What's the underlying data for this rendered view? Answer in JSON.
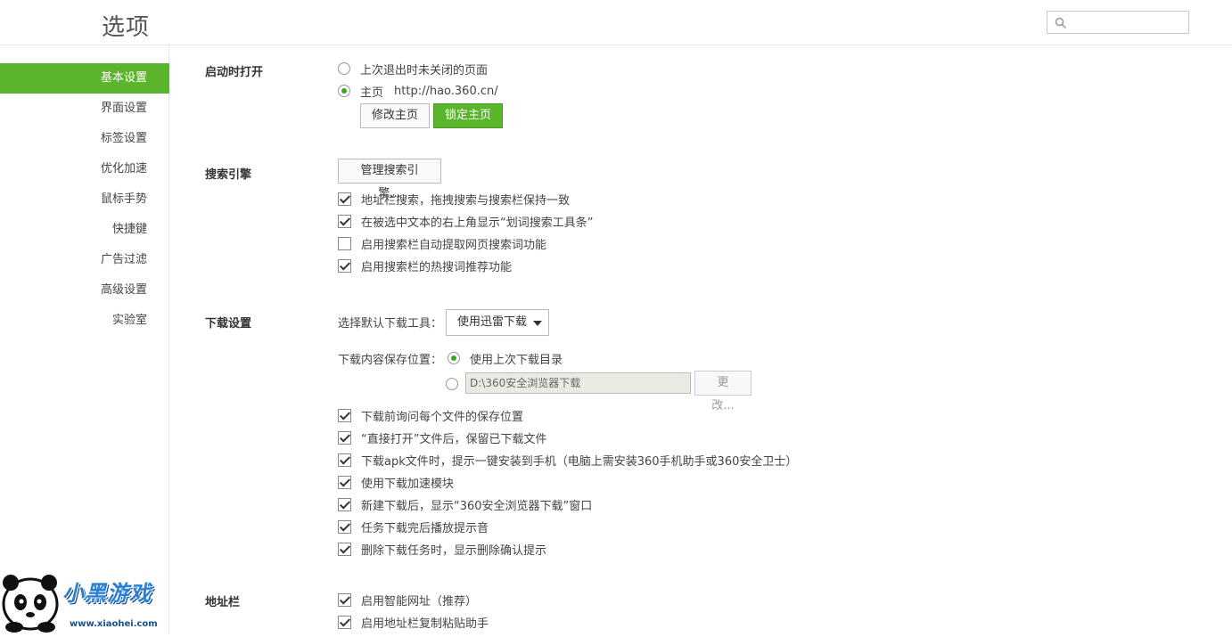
{
  "header": {
    "title": "选项",
    "search_placeholder": ""
  },
  "sidebar": {
    "items": [
      {
        "label": "基本设置",
        "active": true
      },
      {
        "label": "界面设置"
      },
      {
        "label": "标签设置"
      },
      {
        "label": "优化加速"
      },
      {
        "label": "鼠标手势"
      },
      {
        "label": "快捷键"
      },
      {
        "label": "广告过滤"
      },
      {
        "label": "高级设置"
      },
      {
        "label": "实验室"
      }
    ]
  },
  "startup": {
    "title": "启动时打开",
    "option_restore": "上次退出时未关闭的页面",
    "option_home": "主页",
    "home_url": "http://hao.360.cn/",
    "btn_modify": "修改主页",
    "btn_lock": "锁定主页"
  },
  "search": {
    "title": "搜索引擎",
    "btn_manage": "管理搜索引擎...",
    "options": [
      {
        "label": "地址栏搜索，拖拽搜索与搜索栏保持一致",
        "checked": true
      },
      {
        "label": "在被选中文本的右上角显示“划词搜索工具条”",
        "checked": true
      },
      {
        "label": "启用搜索栏自动提取网页搜索词功能",
        "checked": false
      },
      {
        "label": "启用搜索栏的热搜词推荐功能",
        "checked": true
      }
    ]
  },
  "download": {
    "title": "下载设置",
    "tool_label": "选择默认下载工具：",
    "tool_value": "使用迅雷下载",
    "location_label": "下载内容保存位置：",
    "option_last_dir": "使用上次下载目录",
    "path_value": "D:\\360安全浏览器下载",
    "btn_change": "更改...",
    "options": [
      {
        "label": "下载前询问每个文件的保存位置",
        "checked": true
      },
      {
        "label": "“直接打开”文件后，保留已下载文件",
        "checked": true
      },
      {
        "label": "下载apk文件时，提示一键安装到手机（电脑上需安装360手机助手或360安全卫士）",
        "checked": true
      },
      {
        "label": "使用下载加速模块",
        "checked": true
      },
      {
        "label": "新建下载后，显示“360安全浏览器下载”窗口",
        "checked": true
      },
      {
        "label": "任务下载完后播放提示音",
        "checked": true
      },
      {
        "label": "删除下载任务时，显示删除确认提示",
        "checked": true
      }
    ]
  },
  "addressbar": {
    "title": "地址栏",
    "options": [
      {
        "label": "启用智能网址（推荐）",
        "checked": true
      },
      {
        "label": "启用地址栏复制粘贴助手",
        "checked": true
      }
    ]
  },
  "watermark": {
    "brand": "小黑游戏",
    "site": "www.xiaohei.com"
  },
  "colors": {
    "accent": "#5ab52a"
  }
}
